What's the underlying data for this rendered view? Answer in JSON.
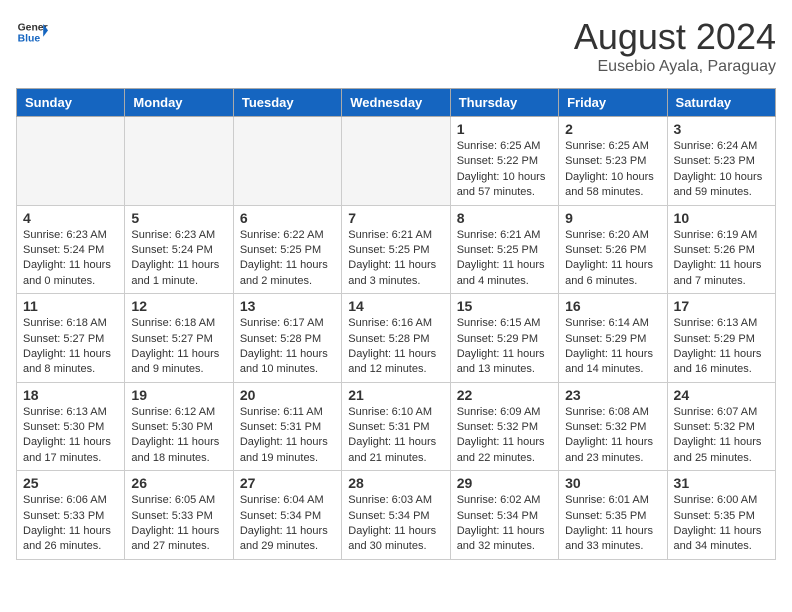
{
  "header": {
    "logo_general": "General",
    "logo_blue": "Blue",
    "month_year": "August 2024",
    "location": "Eusebio Ayala, Paraguay"
  },
  "weekdays": [
    "Sunday",
    "Monday",
    "Tuesday",
    "Wednesday",
    "Thursday",
    "Friday",
    "Saturday"
  ],
  "weeks": [
    [
      {
        "day": "",
        "sunrise": "",
        "sunset": "",
        "daylight": "",
        "empty": true
      },
      {
        "day": "",
        "sunrise": "",
        "sunset": "",
        "daylight": "",
        "empty": true
      },
      {
        "day": "",
        "sunrise": "",
        "sunset": "",
        "daylight": "",
        "empty": true
      },
      {
        "day": "",
        "sunrise": "",
        "sunset": "",
        "daylight": "",
        "empty": true
      },
      {
        "day": "1",
        "sunrise": "Sunrise: 6:25 AM",
        "sunset": "Sunset: 5:22 PM",
        "daylight": "Daylight: 10 hours and 57 minutes.",
        "empty": false
      },
      {
        "day": "2",
        "sunrise": "Sunrise: 6:25 AM",
        "sunset": "Sunset: 5:23 PM",
        "daylight": "Daylight: 10 hours and 58 minutes.",
        "empty": false
      },
      {
        "day": "3",
        "sunrise": "Sunrise: 6:24 AM",
        "sunset": "Sunset: 5:23 PM",
        "daylight": "Daylight: 10 hours and 59 minutes.",
        "empty": false
      }
    ],
    [
      {
        "day": "4",
        "sunrise": "Sunrise: 6:23 AM",
        "sunset": "Sunset: 5:24 PM",
        "daylight": "Daylight: 11 hours and 0 minutes.",
        "empty": false
      },
      {
        "day": "5",
        "sunrise": "Sunrise: 6:23 AM",
        "sunset": "Sunset: 5:24 PM",
        "daylight": "Daylight: 11 hours and 1 minute.",
        "empty": false
      },
      {
        "day": "6",
        "sunrise": "Sunrise: 6:22 AM",
        "sunset": "Sunset: 5:25 PM",
        "daylight": "Daylight: 11 hours and 2 minutes.",
        "empty": false
      },
      {
        "day": "7",
        "sunrise": "Sunrise: 6:21 AM",
        "sunset": "Sunset: 5:25 PM",
        "daylight": "Daylight: 11 hours and 3 minutes.",
        "empty": false
      },
      {
        "day": "8",
        "sunrise": "Sunrise: 6:21 AM",
        "sunset": "Sunset: 5:25 PM",
        "daylight": "Daylight: 11 hours and 4 minutes.",
        "empty": false
      },
      {
        "day": "9",
        "sunrise": "Sunrise: 6:20 AM",
        "sunset": "Sunset: 5:26 PM",
        "daylight": "Daylight: 11 hours and 6 minutes.",
        "empty": false
      },
      {
        "day": "10",
        "sunrise": "Sunrise: 6:19 AM",
        "sunset": "Sunset: 5:26 PM",
        "daylight": "Daylight: 11 hours and 7 minutes.",
        "empty": false
      }
    ],
    [
      {
        "day": "11",
        "sunrise": "Sunrise: 6:18 AM",
        "sunset": "Sunset: 5:27 PM",
        "daylight": "Daylight: 11 hours and 8 minutes.",
        "empty": false
      },
      {
        "day": "12",
        "sunrise": "Sunrise: 6:18 AM",
        "sunset": "Sunset: 5:27 PM",
        "daylight": "Daylight: 11 hours and 9 minutes.",
        "empty": false
      },
      {
        "day": "13",
        "sunrise": "Sunrise: 6:17 AM",
        "sunset": "Sunset: 5:28 PM",
        "daylight": "Daylight: 11 hours and 10 minutes.",
        "empty": false
      },
      {
        "day": "14",
        "sunrise": "Sunrise: 6:16 AM",
        "sunset": "Sunset: 5:28 PM",
        "daylight": "Daylight: 11 hours and 12 minutes.",
        "empty": false
      },
      {
        "day": "15",
        "sunrise": "Sunrise: 6:15 AM",
        "sunset": "Sunset: 5:29 PM",
        "daylight": "Daylight: 11 hours and 13 minutes.",
        "empty": false
      },
      {
        "day": "16",
        "sunrise": "Sunrise: 6:14 AM",
        "sunset": "Sunset: 5:29 PM",
        "daylight": "Daylight: 11 hours and 14 minutes.",
        "empty": false
      },
      {
        "day": "17",
        "sunrise": "Sunrise: 6:13 AM",
        "sunset": "Sunset: 5:29 PM",
        "daylight": "Daylight: 11 hours and 16 minutes.",
        "empty": false
      }
    ],
    [
      {
        "day": "18",
        "sunrise": "Sunrise: 6:13 AM",
        "sunset": "Sunset: 5:30 PM",
        "daylight": "Daylight: 11 hours and 17 minutes.",
        "empty": false
      },
      {
        "day": "19",
        "sunrise": "Sunrise: 6:12 AM",
        "sunset": "Sunset: 5:30 PM",
        "daylight": "Daylight: 11 hours and 18 minutes.",
        "empty": false
      },
      {
        "day": "20",
        "sunrise": "Sunrise: 6:11 AM",
        "sunset": "Sunset: 5:31 PM",
        "daylight": "Daylight: 11 hours and 19 minutes.",
        "empty": false
      },
      {
        "day": "21",
        "sunrise": "Sunrise: 6:10 AM",
        "sunset": "Sunset: 5:31 PM",
        "daylight": "Daylight: 11 hours and 21 minutes.",
        "empty": false
      },
      {
        "day": "22",
        "sunrise": "Sunrise: 6:09 AM",
        "sunset": "Sunset: 5:32 PM",
        "daylight": "Daylight: 11 hours and 22 minutes.",
        "empty": false
      },
      {
        "day": "23",
        "sunrise": "Sunrise: 6:08 AM",
        "sunset": "Sunset: 5:32 PM",
        "daylight": "Daylight: 11 hours and 23 minutes.",
        "empty": false
      },
      {
        "day": "24",
        "sunrise": "Sunrise: 6:07 AM",
        "sunset": "Sunset: 5:32 PM",
        "daylight": "Daylight: 11 hours and 25 minutes.",
        "empty": false
      }
    ],
    [
      {
        "day": "25",
        "sunrise": "Sunrise: 6:06 AM",
        "sunset": "Sunset: 5:33 PM",
        "daylight": "Daylight: 11 hours and 26 minutes.",
        "empty": false
      },
      {
        "day": "26",
        "sunrise": "Sunrise: 6:05 AM",
        "sunset": "Sunset: 5:33 PM",
        "daylight": "Daylight: 11 hours and 27 minutes.",
        "empty": false
      },
      {
        "day": "27",
        "sunrise": "Sunrise: 6:04 AM",
        "sunset": "Sunset: 5:34 PM",
        "daylight": "Daylight: 11 hours and 29 minutes.",
        "empty": false
      },
      {
        "day": "28",
        "sunrise": "Sunrise: 6:03 AM",
        "sunset": "Sunset: 5:34 PM",
        "daylight": "Daylight: 11 hours and 30 minutes.",
        "empty": false
      },
      {
        "day": "29",
        "sunrise": "Sunrise: 6:02 AM",
        "sunset": "Sunset: 5:34 PM",
        "daylight": "Daylight: 11 hours and 32 minutes.",
        "empty": false
      },
      {
        "day": "30",
        "sunrise": "Sunrise: 6:01 AM",
        "sunset": "Sunset: 5:35 PM",
        "daylight": "Daylight: 11 hours and 33 minutes.",
        "empty": false
      },
      {
        "day": "31",
        "sunrise": "Sunrise: 6:00 AM",
        "sunset": "Sunset: 5:35 PM",
        "daylight": "Daylight: 11 hours and 34 minutes.",
        "empty": false
      }
    ]
  ]
}
